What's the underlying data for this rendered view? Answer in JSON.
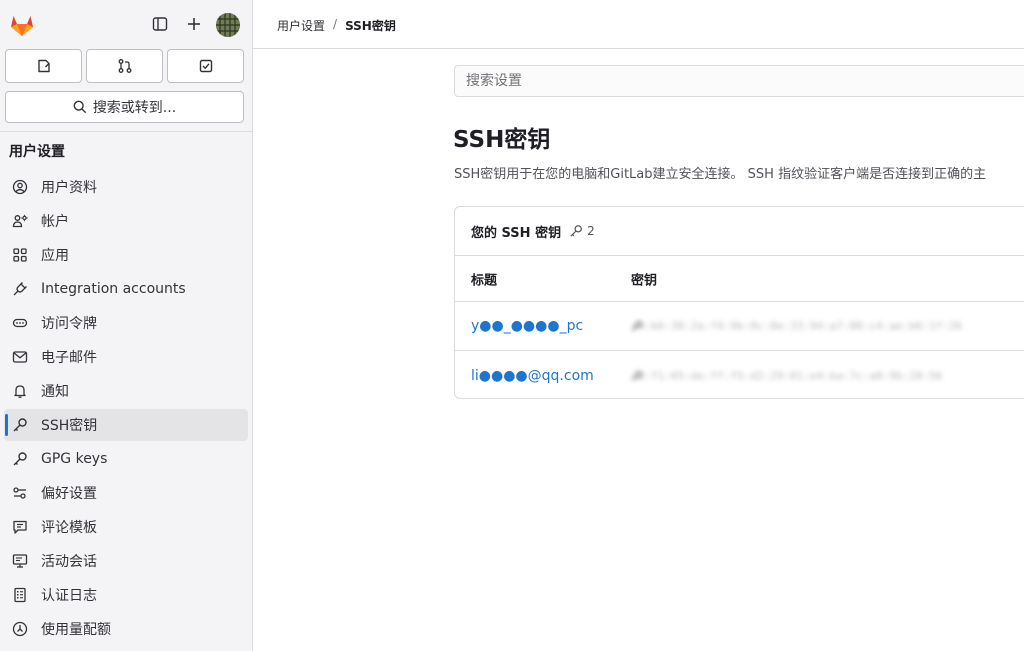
{
  "colors": {
    "accent": "#1f75cb",
    "sidebar_bg": "#f4f4f6",
    "text": "#333238",
    "muted": "#737278"
  },
  "sidebar": {
    "search_label": "搜索或转到...",
    "section_title": "用户设置",
    "items": [
      {
        "label": "用户资料",
        "icon": "user-circle-icon"
      },
      {
        "label": "帐户",
        "icon": "account-icon"
      },
      {
        "label": "应用",
        "icon": "applications-icon"
      },
      {
        "label": "Integration accounts",
        "icon": "plug-icon"
      },
      {
        "label": "访问令牌",
        "icon": "token-icon"
      },
      {
        "label": "电子邮件",
        "icon": "mail-icon"
      },
      {
        "label": "通知",
        "icon": "bell-icon"
      },
      {
        "label": "SSH密钥",
        "icon": "key-icon",
        "active": true
      },
      {
        "label": "GPG keys",
        "icon": "key-icon"
      },
      {
        "label": "偏好设置",
        "icon": "preferences-icon"
      },
      {
        "label": "评论模板",
        "icon": "comment-icon"
      },
      {
        "label": "活动会话",
        "icon": "monitor-icon"
      },
      {
        "label": "认证日志",
        "icon": "log-icon"
      },
      {
        "label": "使用量配额",
        "icon": "quota-icon"
      }
    ]
  },
  "breadcrumb": {
    "parent": "用户设置",
    "separator": "/",
    "current": "SSH密钥"
  },
  "main": {
    "search_placeholder": "搜索设置",
    "title": "SSH密钥",
    "description": "SSH密钥用于在您的电脑和GitLab建立安全连接。 SSH 指纹验证客户端是否连接到正确的主",
    "card": {
      "header": "您的 SSH 密钥",
      "count": "2",
      "columns": [
        "标题",
        "密钥"
      ],
      "rows": [
        {
          "title": "y●●_●●●●_pc",
          "key": "c4:b6:38:2a:f4:9b:0c:8e:33:94:a7:88:c4:ae:b6:1f:26"
        },
        {
          "title": "li●●●●@qq.com",
          "key": "a3:f1:05:de:ff:f5:d2:29:01:e4:ba:7c:a0:9b:28:56"
        }
      ]
    }
  }
}
